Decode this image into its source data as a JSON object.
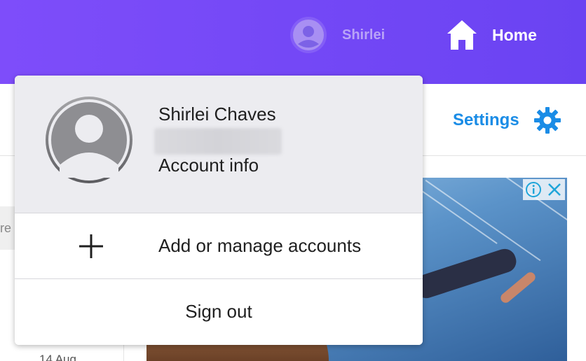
{
  "header": {
    "user_name": "Shirlei",
    "home_label": "Home",
    "colors": {
      "bar": "#7e4dfa",
      "home_text": "#ffffff",
      "user_text": "#b9a3f7"
    }
  },
  "subbar": {
    "settings_label": "Settings",
    "settings_icon": "gear-icon",
    "accent": "#1a8ce6"
  },
  "sidebar": {
    "partial_tab": "re",
    "partial_date": "14 Aug"
  },
  "ad": {
    "info_icon": "info-icon",
    "close_icon": "close-icon"
  },
  "account_menu": {
    "name": "Shirlei Chaves",
    "account_info_label": "Account info",
    "add_accounts_label": "Add or manage accounts",
    "sign_out_label": "Sign out",
    "icons": {
      "avatar": "avatar-icon",
      "add": "plus-icon"
    }
  }
}
